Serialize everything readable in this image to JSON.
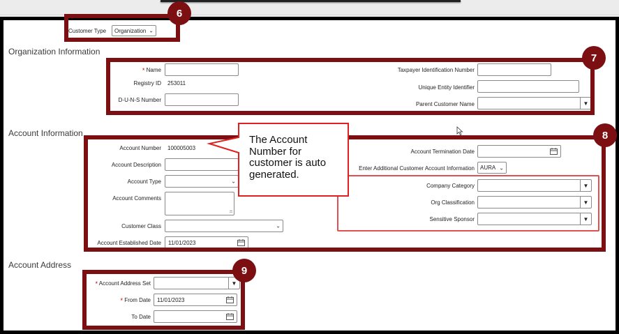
{
  "customer_type": {
    "label": "Customer Type",
    "value": "Organization"
  },
  "org_info": {
    "title": "Organization Information",
    "name_label": "Name",
    "registry_label": "Registry ID",
    "registry_value": "253011",
    "duns_label": "D-U-N-S Number",
    "tin_label": "Taxpayer Identification Number",
    "uei_label": "Unique Entity Identifier",
    "parent_label": "Parent Customer Name"
  },
  "account_info": {
    "title": "Account Information",
    "number_label": "Account Number",
    "number_value": "100005003",
    "description_label": "Account Description",
    "type_label": "Account Type",
    "comments_label": "Account Comments",
    "class_label": "Customer Class",
    "established_label": "Account Established Date",
    "established_value": "11/01/2023",
    "termination_label": "Account Termination Date",
    "additional_label": "Enter Additional Customer Account Information",
    "additional_value": "AURA",
    "company_category_label": "Company Category",
    "org_classification_label": "Org Classification",
    "sensitive_sponsor_label": "Sensitive Sponsor"
  },
  "account_address": {
    "title": "Account Address",
    "set_label": "Account Address Set",
    "from_label": "From Date",
    "from_value": "11/01/2023",
    "to_label": "To Date"
  },
  "callout": {
    "text": "The Account Number for customer is auto generated."
  },
  "badges": {
    "six": "6",
    "seven": "7",
    "eight": "8",
    "nine": "9"
  },
  "colors": {
    "annotation": "#7b0f12",
    "callout_border": "#e02020",
    "highlight": "#e05050"
  }
}
